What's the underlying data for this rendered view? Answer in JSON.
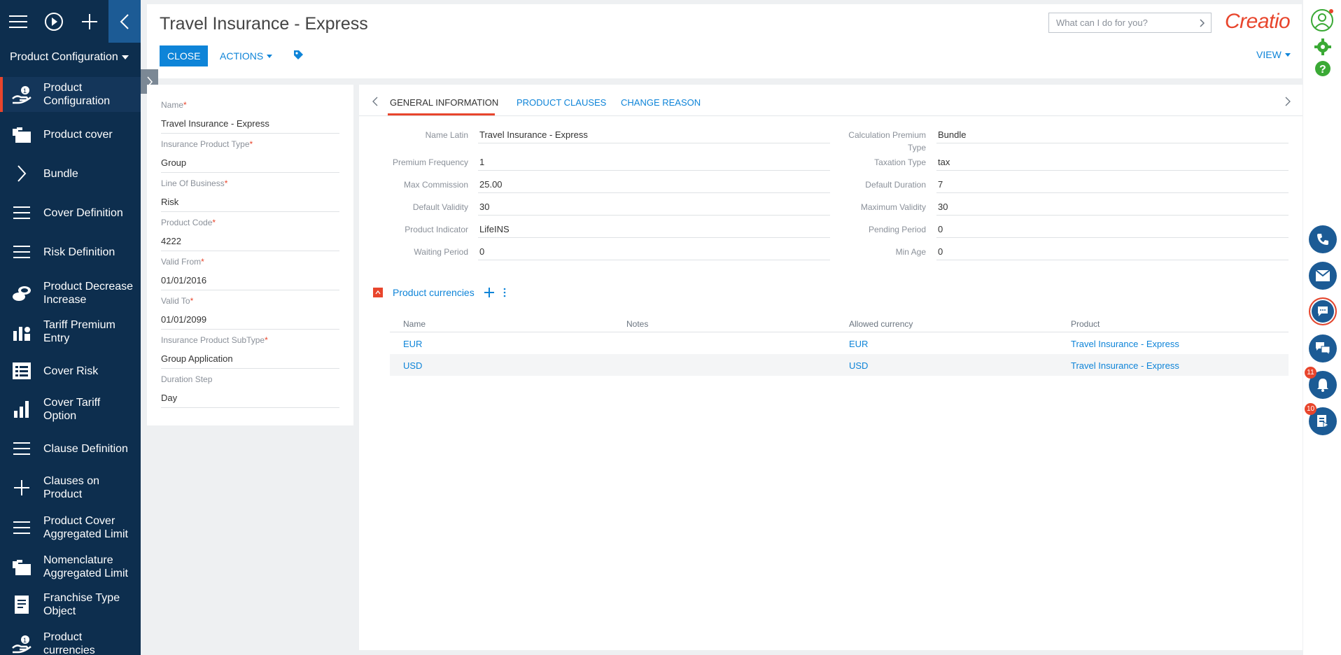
{
  "sidebar": {
    "workplace": "Product Configuration",
    "items": [
      {
        "label": "Product Configuration",
        "icon": "hand-coin-icon"
      },
      {
        "label": "Product cover",
        "icon": "folders-icon"
      },
      {
        "label": "Bundle",
        "icon": "chevron-right-icon"
      },
      {
        "label": "Cover Definition",
        "icon": "list-icon"
      },
      {
        "label": "Risk Definition",
        "icon": "list-icon"
      },
      {
        "label": "Product Decrease Increase",
        "icon": "coins-icon"
      },
      {
        "label": "Tariff Premium Entry",
        "icon": "people-chart-icon"
      },
      {
        "label": "Cover Risk",
        "icon": "document-list-icon"
      },
      {
        "label": "Cover Tariff Option",
        "icon": "bar-chart-icon"
      },
      {
        "label": "Clause Definition",
        "icon": "list-icon"
      },
      {
        "label": "Clauses on Product",
        "icon": "plus-icon"
      },
      {
        "label": "Product Cover Aggregated Limit",
        "icon": "list-icon"
      },
      {
        "label": "Nomenclature Aggregated Limit",
        "icon": "folders-icon"
      },
      {
        "label": "Franchise Type Object",
        "icon": "document-icon"
      },
      {
        "label": "Product currencies",
        "icon": "hand-coin-icon"
      }
    ]
  },
  "header": {
    "title": "Travel Insurance - Express",
    "close_label": "CLOSE",
    "actions_label": "ACTIONS",
    "view_label": "VIEW",
    "search_placeholder": "What can I do for you?",
    "logo_text": "Creatio"
  },
  "left_form": [
    {
      "label": "Name",
      "required": true,
      "value": "Travel Insurance - Express"
    },
    {
      "label": "Insurance Product Type",
      "required": true,
      "value": "Group"
    },
    {
      "label": "Line Of Business",
      "required": true,
      "value": "Risk"
    },
    {
      "label": "Product Code",
      "required": true,
      "value": "4222"
    },
    {
      "label": "Valid From",
      "required": true,
      "value": "01/01/2016"
    },
    {
      "label": "Valid To",
      "required": true,
      "value": "01/01/2099"
    },
    {
      "label": "Insurance Product SubType",
      "required": true,
      "value": "Group Application"
    },
    {
      "label": "Duration Step",
      "required": false,
      "value": "Day"
    }
  ],
  "tabs": [
    "GENERAL INFORMATION",
    "PRODUCT CLAUSES",
    "CHANGE REASON"
  ],
  "general": {
    "left": [
      {
        "label": "Name Latin",
        "value": "Travel Insurance - Express"
      },
      {
        "label": "Premium Frequency",
        "value": "1"
      },
      {
        "label": "Max Commission",
        "value": "25.00"
      },
      {
        "label": "Default Validity",
        "value": "30"
      },
      {
        "label": "Product Indicator",
        "value": "LifeINS"
      },
      {
        "label": "Waiting Period",
        "value": "0"
      }
    ],
    "right": [
      {
        "label": "Calculation Premium Type",
        "value": "Bundle"
      },
      {
        "label": "Taxation Type",
        "value": "tax"
      },
      {
        "label": "Default Duration",
        "value": "7"
      },
      {
        "label": "Maximum Validity",
        "value": "30"
      },
      {
        "label": "Pending Period",
        "value": "0"
      },
      {
        "label": "Min Age",
        "value": "0"
      }
    ]
  },
  "currencies": {
    "title": "Product currencies",
    "columns": [
      "Name",
      "Notes",
      "Allowed currency",
      "Product"
    ],
    "rows": [
      [
        "EUR",
        "",
        "EUR",
        "Travel Insurance - Express"
      ],
      [
        "USD",
        "",
        "USD",
        "Travel Insurance - Express"
      ]
    ]
  },
  "rightbar": {
    "notifications_count": "11",
    "feed_count": "10"
  },
  "colors": {
    "sidebar_bg": "#0d2e4e",
    "accent_red": "#e8452c",
    "link_blue": "#0e84d8"
  }
}
